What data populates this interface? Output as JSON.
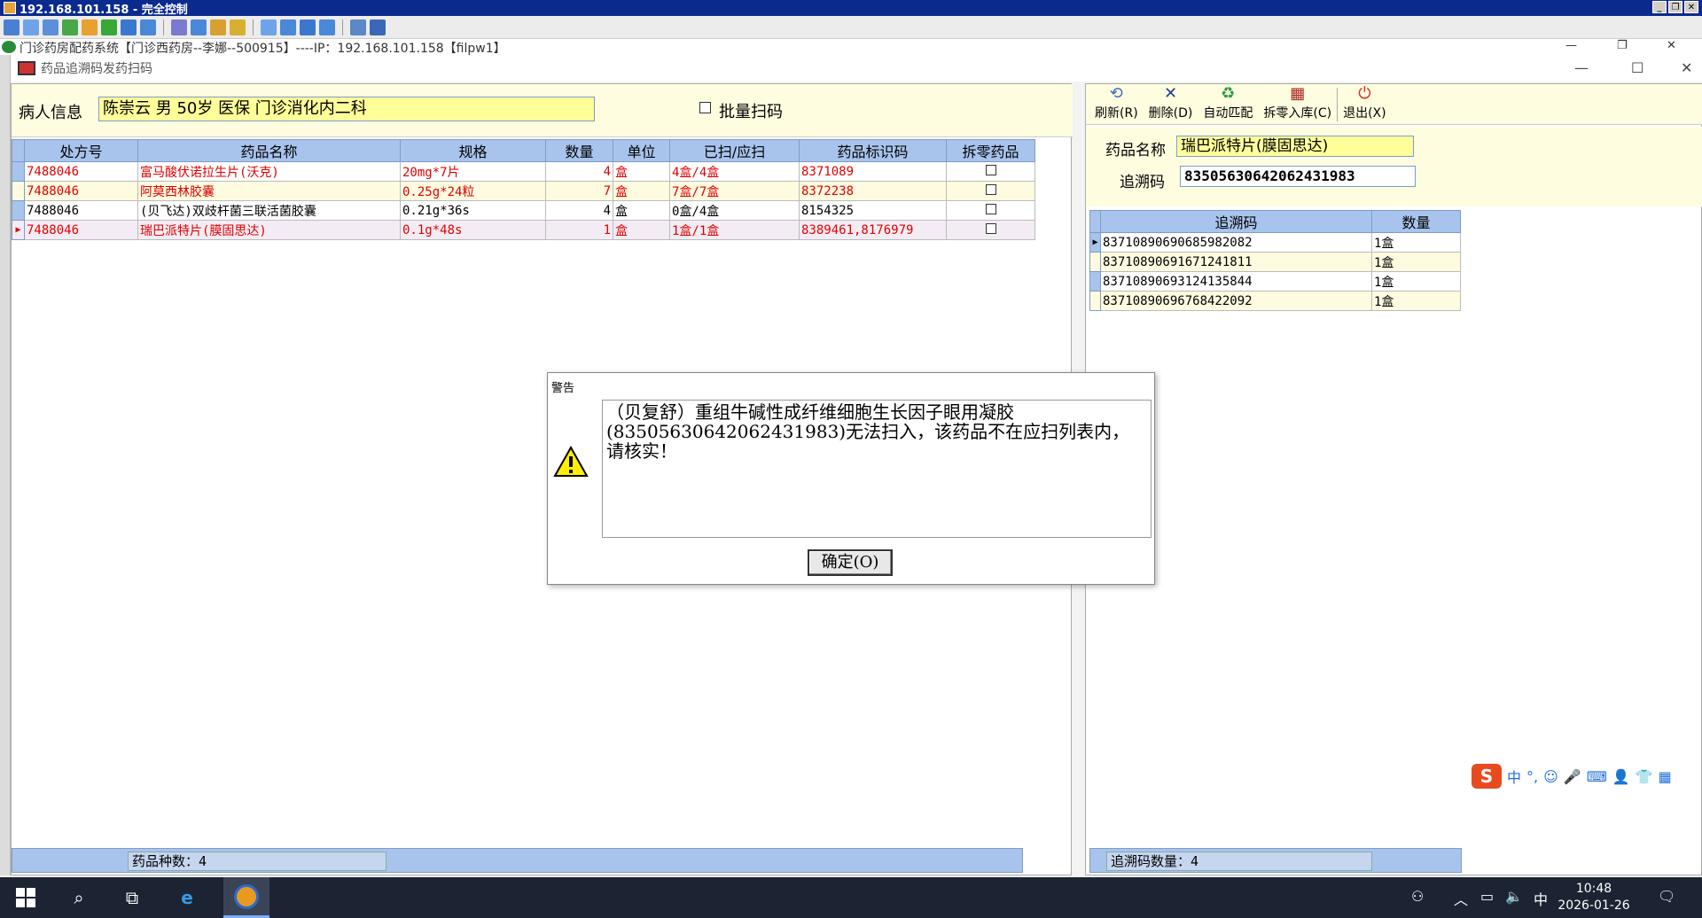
{
  "remote": {
    "title": "192.168.101.158 - 完全控制"
  },
  "app": {
    "title": "门诊药房配药系统【门诊西药房--李娜--500915】----IP：192.168.101.158【filpw1】"
  },
  "window": {
    "title": "药品追溯码发药扫码",
    "minimize": "—",
    "maximize": "☐",
    "close": "✕"
  },
  "patient": {
    "label": "病人信息",
    "value": "陈崇云 男 50岁 医保 门诊消化内二科",
    "batch_label": "批量扫码"
  },
  "grid": {
    "headers": [
      "处方号",
      "药品名称",
      "规格",
      "数量",
      "单位",
      "已扫/应扫",
      "药品标识码",
      "拆零药品"
    ],
    "rows": [
      {
        "rx": "7488046",
        "name": "富马酸伏诺拉生片(沃克)",
        "spec": "20mg*7片",
        "qty": "4",
        "unit": "盒",
        "scanned": "4盒/4盒",
        "code": "8371089",
        "style": "red",
        "indicator": ""
      },
      {
        "rx": "7488046",
        "name": "阿莫西林胶囊",
        "spec": "0.25g*24粒",
        "qty": "7",
        "unit": "盒",
        "scanned": "7盒/7盒",
        "code": "8372238",
        "style": "red alt",
        "indicator": ""
      },
      {
        "rx": "7488046",
        "name": "(贝飞达)双歧杆菌三联活菌胶囊",
        "spec": "0.21g*36s",
        "qty": "4",
        "unit": "盒",
        "scanned": "0盒/4盒",
        "code": "8154325",
        "style": "",
        "indicator": ""
      },
      {
        "rx": "7488046",
        "name": "瑞巴派特片(膜固思达)",
        "spec": "0.1g*48s",
        "qty": "1",
        "unit": "盒",
        "scanned": "1盒/1盒",
        "code": "8389461,8176979",
        "style": "red sel",
        "indicator": "▶"
      }
    ],
    "footer_label": "药品种数：4"
  },
  "right_toolbar": [
    {
      "label": "刷新(R)",
      "icon": "refresh-icon",
      "glyph": "⟲",
      "color": "#3a6fc8"
    },
    {
      "label": "删除(D)",
      "icon": "delete-icon",
      "glyph": "✕",
      "color": "#1f3f8f"
    },
    {
      "label": "自动匹配",
      "icon": "auto-match-icon",
      "glyph": "♻",
      "color": "#2a9a4a"
    },
    {
      "label": "拆零入库(C)",
      "icon": "unpack-icon",
      "glyph": "▦",
      "color": "#aa2222"
    },
    {
      "label": "退出(X)",
      "icon": "exit-icon",
      "glyph": "⏻",
      "color": "#dd2222"
    }
  ],
  "drug_fields": {
    "name_label": "药品名称",
    "name_value": "瑞巴派特片(膜固思达)",
    "trace_label": "追溯码",
    "trace_value": "83505630642062431983"
  },
  "trace_grid": {
    "headers": [
      "追溯码",
      "数量"
    ],
    "rows": [
      {
        "code": "83710890690685982082",
        "qty": "1盒",
        "indicator": "▶"
      },
      {
        "code": "83710890691671241811",
        "qty": "1盒",
        "indicator": ""
      },
      {
        "code": "83710890693124135844",
        "qty": "1盒",
        "indicator": ""
      },
      {
        "code": "83710890696768422092",
        "qty": "1盒",
        "indicator": ""
      }
    ],
    "footer_label": "追溯码数量：4"
  },
  "dialog": {
    "title": "警告",
    "message": "（贝复舒）重组牛碱性成纤维细胞生长因子眼用凝胶(83505630642062431983)无法扫入，该药品不在应扫列表内，请核实！",
    "ok_label": "确定(O)"
  },
  "ime": {
    "logo": "S",
    "mode": "中",
    "punct": "°,"
  },
  "taskbar": {
    "time": "10:48",
    "date": "2026-01-26",
    "ime_lang": "中"
  }
}
